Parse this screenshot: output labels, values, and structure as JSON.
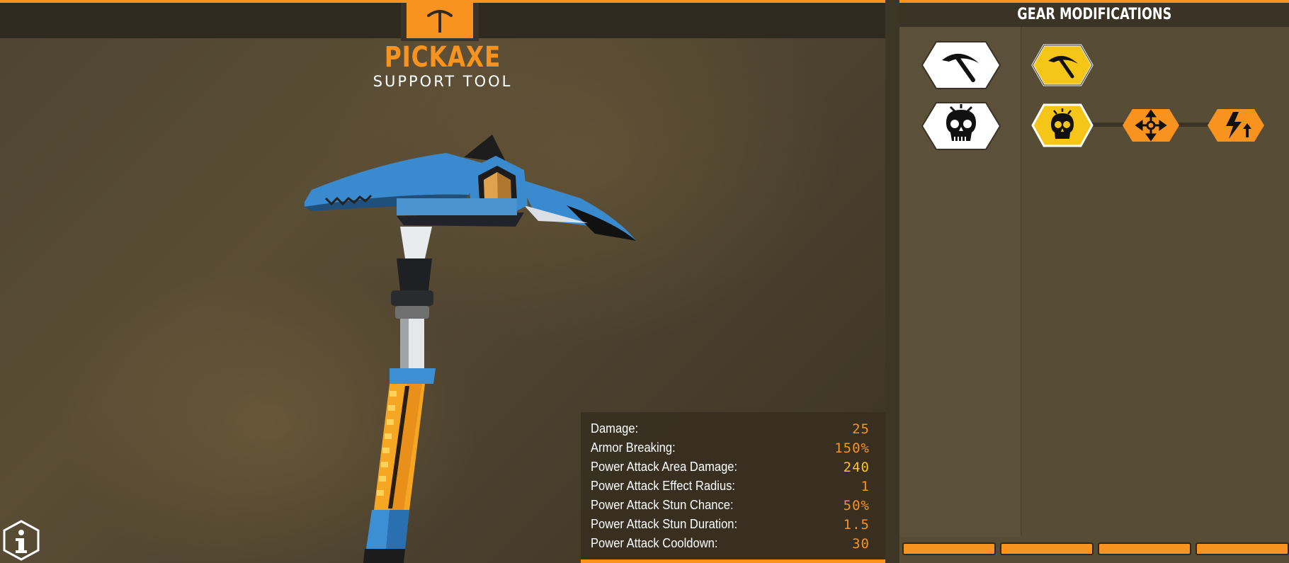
{
  "item": {
    "name": "PICKAXE",
    "type": "SUPPORT TOOL",
    "icon": "pickaxe-icon"
  },
  "stats": [
    {
      "label": "Damage:",
      "value": "25",
      "highlight": false
    },
    {
      "label": "Armor Breaking:",
      "value": "150%",
      "highlight": false
    },
    {
      "label": "Power Attack Area Damage:",
      "value": "240",
      "highlight": true
    },
    {
      "label": "Power Attack Effect Radius:",
      "value": "1",
      "highlight": false
    },
    {
      "label": "Power Attack Stun Chance:",
      "value": "50%",
      "highlight": false
    },
    {
      "label": "Power Attack Stun Duration:",
      "value": "1.5",
      "highlight": false
    },
    {
      "label": "Power Attack Cooldown:",
      "value": "30",
      "highlight": false
    }
  ],
  "mods_panel": {
    "title": "GEAR MODIFICATIONS",
    "rows": [
      {
        "category_icon": "pickaxe-icon",
        "options": [
          {
            "icon": "pickaxe-icon",
            "selected": true
          }
        ]
      },
      {
        "category_icon": "skull-icon",
        "options": [
          {
            "icon": "skull-icon",
            "selected": true
          },
          {
            "icon": "move-arrows-icon",
            "selected": false
          },
          {
            "icon": "lightning-boost-icon",
            "selected": false
          }
        ]
      }
    ],
    "tab_count": 4
  },
  "colors": {
    "accent": "#f7931e",
    "selected_mod": "#f5c518",
    "panel_dark": "#2f2a20"
  },
  "info_icon": "info-icon"
}
